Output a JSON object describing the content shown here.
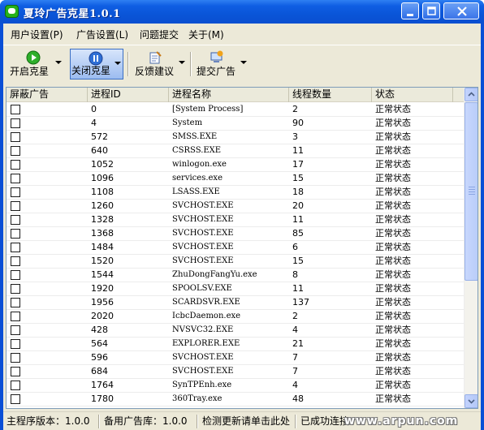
{
  "window": {
    "title": "夏玲广告克星1.0.1"
  },
  "menu": [
    {
      "label": "用户设置(P)"
    },
    {
      "label": "广告设置(L)"
    },
    {
      "label": "问题提交"
    },
    {
      "label": "关于(M)"
    }
  ],
  "toolbar": {
    "start": "开启克星",
    "stop": "关闭克星",
    "feedback": "反馈建议",
    "submit": "提交广告"
  },
  "list": {
    "columns": [
      "屏蔽广告",
      "进程ID",
      "进程名称",
      "线程数量",
      "状态"
    ],
    "rows": [
      {
        "pid": "0",
        "name": "[System Process]",
        "threads": "2",
        "status": "正常状态"
      },
      {
        "pid": "4",
        "name": "System",
        "threads": "90",
        "status": "正常状态"
      },
      {
        "pid": "572",
        "name": "SMSS.EXE",
        "threads": "3",
        "status": "正常状态"
      },
      {
        "pid": "640",
        "name": "CSRSS.EXE",
        "threads": "11",
        "status": "正常状态"
      },
      {
        "pid": "1052",
        "name": "winlogon.exe",
        "threads": "17",
        "status": "正常状态"
      },
      {
        "pid": "1096",
        "name": "services.exe",
        "threads": "15",
        "status": "正常状态"
      },
      {
        "pid": "1108",
        "name": "LSASS.EXE",
        "threads": "18",
        "status": "正常状态"
      },
      {
        "pid": "1260",
        "name": "SVCHOST.EXE",
        "threads": "20",
        "status": "正常状态"
      },
      {
        "pid": "1328",
        "name": "SVCHOST.EXE",
        "threads": "11",
        "status": "正常状态"
      },
      {
        "pid": "1368",
        "name": "SVCHOST.EXE",
        "threads": "85",
        "status": "正常状态"
      },
      {
        "pid": "1484",
        "name": "SVCHOST.EXE",
        "threads": "6",
        "status": "正常状态"
      },
      {
        "pid": "1520",
        "name": "SVCHOST.EXE",
        "threads": "15",
        "status": "正常状态"
      },
      {
        "pid": "1544",
        "name": "ZhuDongFangYu.exe",
        "threads": "8",
        "status": "正常状态"
      },
      {
        "pid": "1920",
        "name": "SPOOLSV.EXE",
        "threads": "11",
        "status": "正常状态"
      },
      {
        "pid": "1956",
        "name": "SCARDSVR.EXE",
        "threads": "137",
        "status": "正常状态"
      },
      {
        "pid": "2020",
        "name": "IcbcDaemon.exe",
        "threads": "2",
        "status": "正常状态"
      },
      {
        "pid": "428",
        "name": "NVSVC32.EXE",
        "threads": "4",
        "status": "正常状态"
      },
      {
        "pid": "564",
        "name": "EXPLORER.EXE",
        "threads": "21",
        "status": "正常状态"
      },
      {
        "pid": "596",
        "name": "SVCHOST.EXE",
        "threads": "7",
        "status": "正常状态"
      },
      {
        "pid": "684",
        "name": "SVCHOST.EXE",
        "threads": "7",
        "status": "正常状态"
      },
      {
        "pid": "1764",
        "name": "SynTPEnh.exe",
        "threads": "4",
        "status": "正常状态"
      },
      {
        "pid": "1780",
        "name": "360Tray.exe",
        "threads": "48",
        "status": "正常状态"
      }
    ]
  },
  "statusbar": {
    "main_version": "主程序版本：1.0.0",
    "ad_library": "备用广告库：1.0.0",
    "update_hint": "检测更新请单击此处",
    "connected": "已成功连接",
    "watermark": "www.arpun.com"
  },
  "colors": {
    "titlebar": "#0a55d8",
    "client": "#ece9d8",
    "active_button": "#9cbcf0"
  }
}
